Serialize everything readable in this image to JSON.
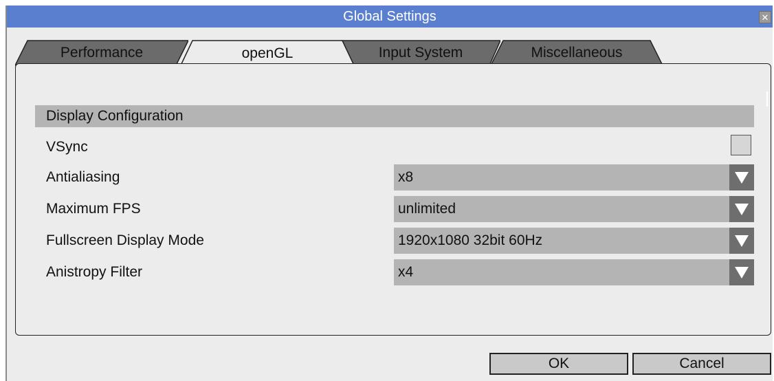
{
  "window": {
    "title": "Global Settings",
    "close_glyph": "✕",
    "accent": "#5a7fce"
  },
  "tabs": [
    {
      "label": "Performance",
      "active": false
    },
    {
      "label": "openGL",
      "active": true
    },
    {
      "label": "Input System",
      "active": false
    },
    {
      "label": "Miscellaneous",
      "active": false
    }
  ],
  "section": {
    "title": "Display Configuration",
    "rows": [
      {
        "label": "VSync",
        "type": "checkbox",
        "checked": false
      },
      {
        "label": "Antialiasing",
        "type": "select",
        "value": "x8"
      },
      {
        "label": "Maximum FPS",
        "type": "select",
        "value": "unlimited"
      },
      {
        "label": "Fullscreen Display Mode",
        "type": "select",
        "value": "1920x1080 32bit 60Hz"
      },
      {
        "label": "Anistropy Filter",
        "type": "select",
        "value": "x4"
      }
    ]
  },
  "buttons": {
    "ok": "OK",
    "cancel": "Cancel"
  },
  "icons": {
    "dropdown": "triangle-down-icon",
    "close": "close-icon"
  }
}
